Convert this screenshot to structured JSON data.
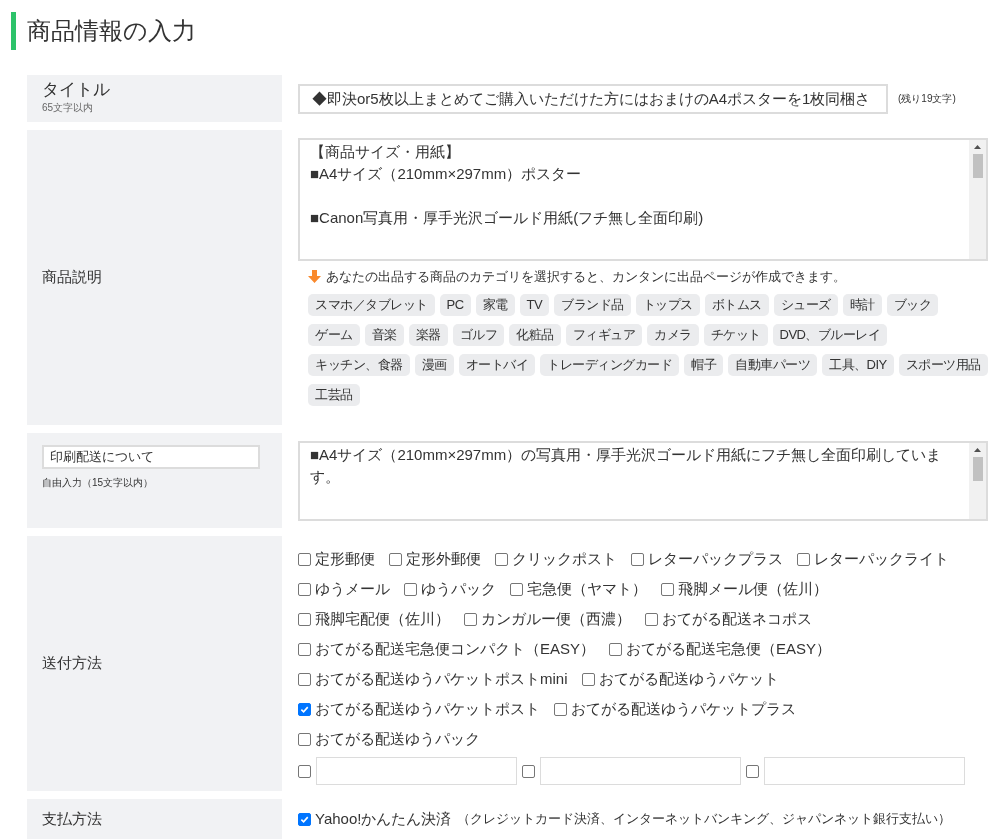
{
  "heading": "商品情報の入力",
  "title_row": {
    "label": "タイトル",
    "note": "65文字以内",
    "value": "◆即決or5枚以上まとめてご購入いただけた方にはおまけのA4ポスターを1枚同梱さ",
    "remaining": "(残り19文字)"
  },
  "description_row": {
    "label": "商品説明",
    "paragraphs": [
      [
        "【商品サイズ・用紙】",
        "■A4サイズ（210mm×297mm）ポスター"
      ],
      [
        "■Canon写真用・厚手光沢ゴールド用紙(フチ無し全面印刷)"
      ]
    ],
    "hint": "あなたの出品する商品のカテゴリを選択すると、カンタンに出品ページが作成できます。",
    "categories": [
      "スマホ／タブレット",
      "PC",
      "家電",
      "TV",
      "ブランド品",
      "トップス",
      "ボトムス",
      "シューズ",
      "時計",
      "ブック",
      "ゲーム",
      "音楽",
      "楽器",
      "ゴルフ",
      "化粧品",
      "フィギュア",
      "カメラ",
      "チケット",
      "DVD、ブルーレイ",
      "キッチン、食器",
      "漫画",
      "オートバイ",
      "トレーディングカード",
      "帽子",
      "自動車パーツ",
      "工具、DIY",
      "スポーツ用品",
      "工芸品"
    ]
  },
  "custom_row": {
    "label_value": "印刷配送について",
    "note": "自由入力（15文字以内）",
    "paragraphs": [
      [
        "■A4サイズ（210mm×297mm）の写真用・厚手光沢ゴールド用紙にフチ無し全面印刷していま",
        "す。"
      ]
    ]
  },
  "shipping_row": {
    "label": "送付方法",
    "options": [
      [
        {
          "label": "定形郵便",
          "checked": false
        },
        {
          "label": "定形外郵便",
          "checked": false
        },
        {
          "label": "クリックポスト",
          "checked": false
        },
        {
          "label": "レターパックプラス",
          "checked": false
        },
        {
          "label": "レターパックライト",
          "checked": false
        }
      ],
      [
        {
          "label": "ゆうメール",
          "checked": false
        },
        {
          "label": "ゆうパック",
          "checked": false
        },
        {
          "label": "宅急便（ヤマト）",
          "checked": false
        },
        {
          "label": "飛脚メール便（佐川）",
          "checked": false
        }
      ],
      [
        {
          "label": "飛脚宅配便（佐川）",
          "checked": false
        },
        {
          "label": "カンガルー便（西濃）",
          "checked": false
        },
        {
          "label": "おてがる配送ネコポス",
          "checked": false
        }
      ],
      [
        {
          "label": "おてがる配送宅急便コンパクト（EASY）",
          "checked": false
        },
        {
          "label": "おてがる配送宅急便（EASY）",
          "checked": false
        }
      ],
      [
        {
          "label": "おてがる配送ゆうパケットポストmini",
          "checked": false
        },
        {
          "label": "おてがる配送ゆうパケット",
          "checked": false
        }
      ],
      [
        {
          "label": "おてがる配送ゆうパケットポスト",
          "checked": true
        },
        {
          "label": "おてがる配送ゆうパケットプラス",
          "checked": false
        }
      ],
      [
        {
          "label": "おてがる配送ゆうパック",
          "checked": false
        }
      ]
    ],
    "custom_options": [
      {
        "checked": false
      },
      {
        "checked": false
      },
      {
        "checked": false
      }
    ]
  },
  "payment_row": {
    "label": "支払方法",
    "option": {
      "label": "Yahoo!かんたん決済",
      "note": "（クレジットカード決済、インターネットバンキング、ジャパンネット銀行支払い）",
      "checked": true
    }
  }
}
